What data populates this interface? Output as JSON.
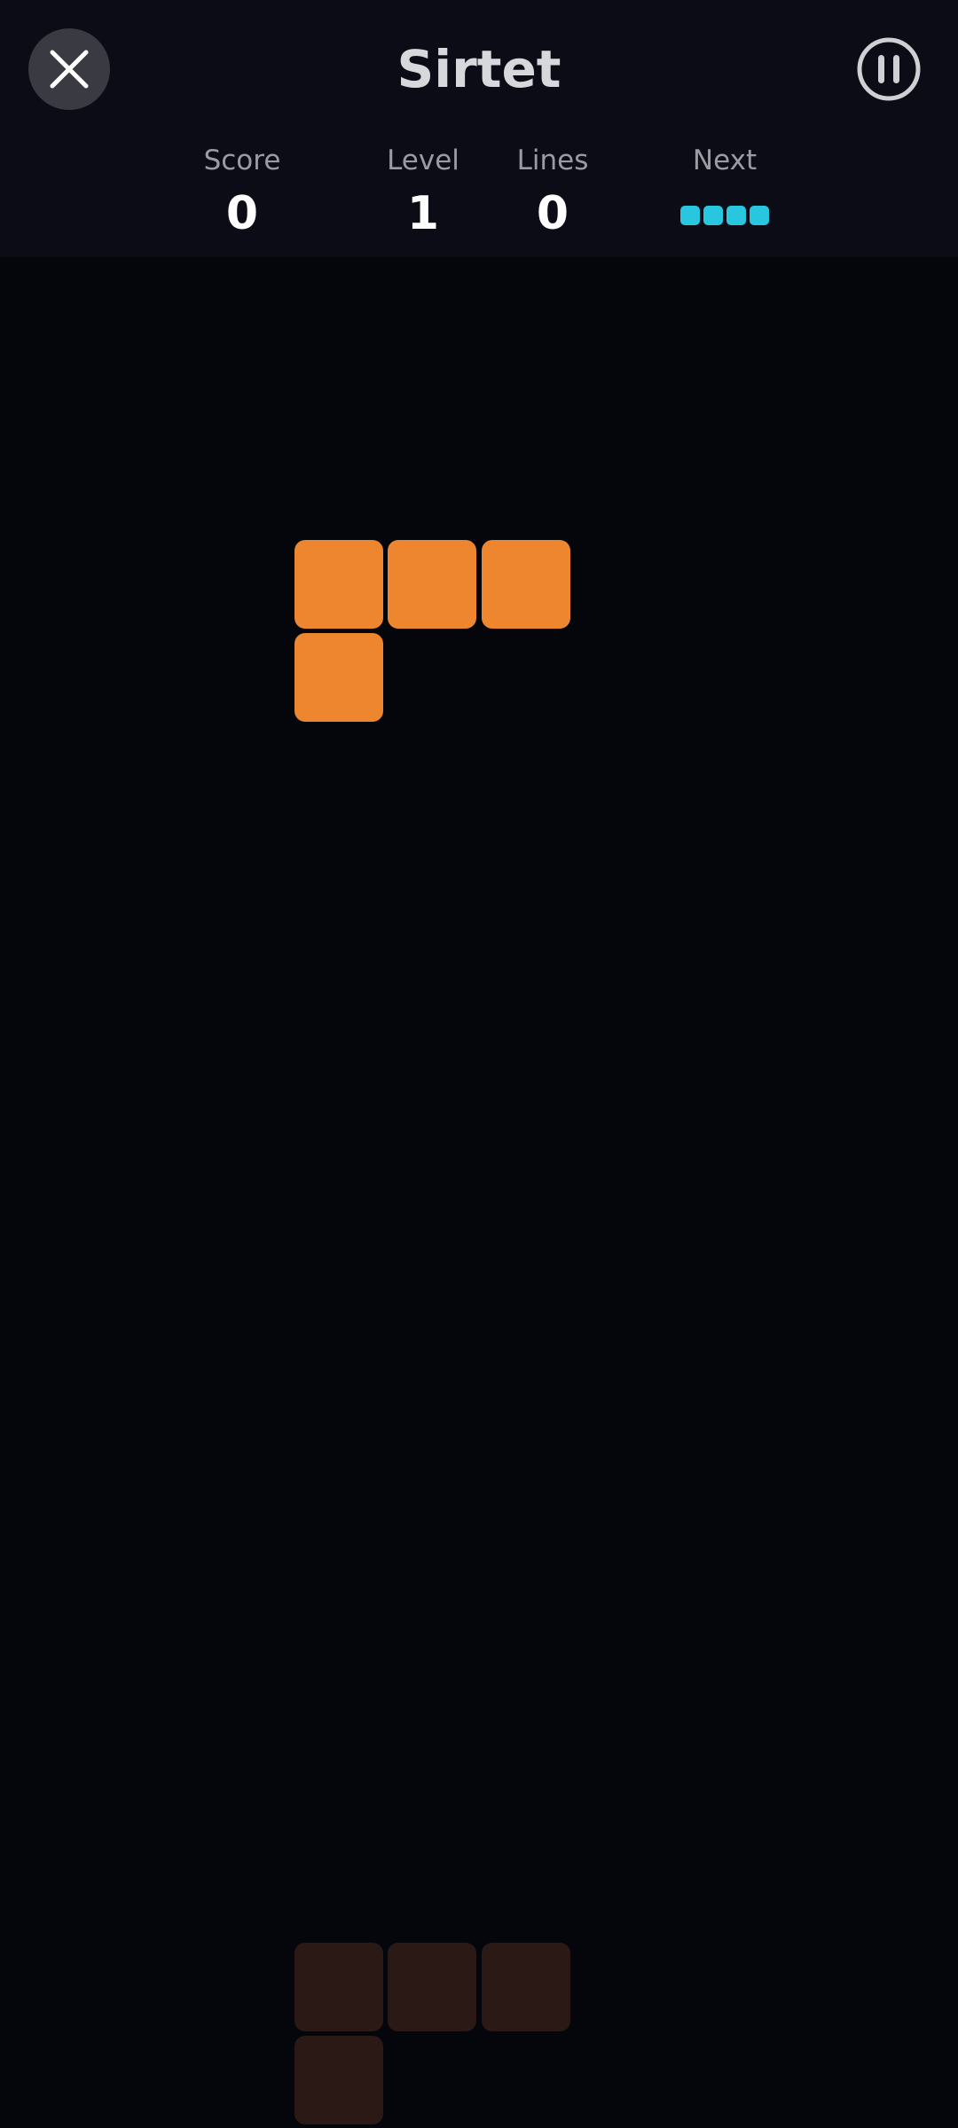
{
  "header": {
    "title": "Sirtet"
  },
  "stats": {
    "score_label": "Score",
    "score_value": "0",
    "level_label": "Level",
    "level_value": "1",
    "lines_label": "Lines",
    "lines_value": "0",
    "next_label": "Next"
  },
  "next_piece": {
    "shape": "I",
    "color": "#29c6e0"
  },
  "board": {
    "active_piece": {
      "shape": "L",
      "color": "#ee8630"
    },
    "ghost_piece": {
      "color": "#2a1914"
    }
  },
  "icons": {
    "close": "close-icon",
    "pause": "pause-icon"
  }
}
